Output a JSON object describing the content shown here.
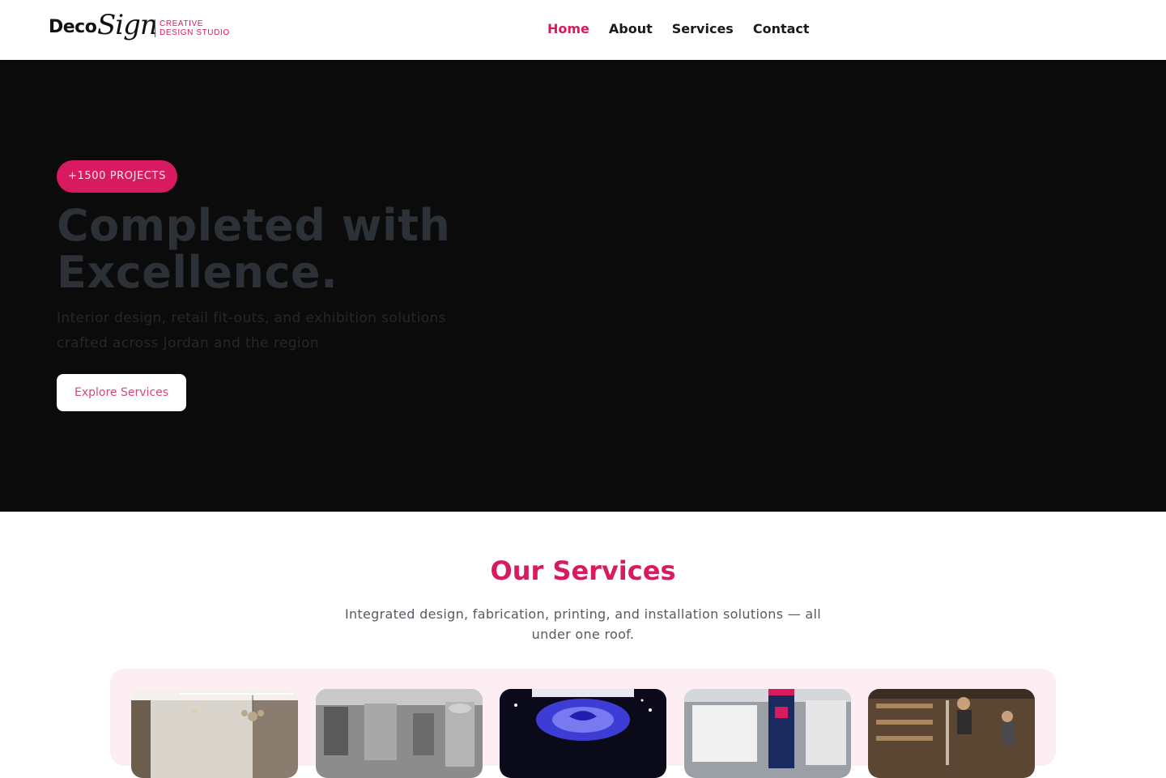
{
  "header": {
    "logo": {
      "word1": "Deco",
      "word2": "Sign",
      "tagline_line1": "CREATIVE",
      "tagline_line2": "DESIGN STUDIO"
    },
    "nav": [
      {
        "label": "Home",
        "active": true
      },
      {
        "label": "About",
        "active": false
      },
      {
        "label": "Services",
        "active": false
      },
      {
        "label": "Contact",
        "active": false
      }
    ]
  },
  "hero": {
    "badge": "+1500 PROJECTS",
    "title": "Completed with Excellence.",
    "subtitle": "Interior design, retail fit-outs, and exhibition solutions crafted across Jordan and the region",
    "cta": "Explore Services"
  },
  "services": {
    "title": "Our Services",
    "subtitle": "Integrated design, fabrication, printing, and installation solutions — all under one roof.",
    "cards": [
      {
        "image": "interior-living-room-photo"
      },
      {
        "image": "fabrication-workshop-photo"
      },
      {
        "image": "exhibition-booth-lighting-photo"
      },
      {
        "image": "retail-signage-display-photo"
      },
      {
        "image": "installation-team-photo"
      }
    ]
  },
  "colors": {
    "accent": "#d81b60",
    "hero_background": "#0b0b0c",
    "cards_background": "#fdeef4"
  }
}
